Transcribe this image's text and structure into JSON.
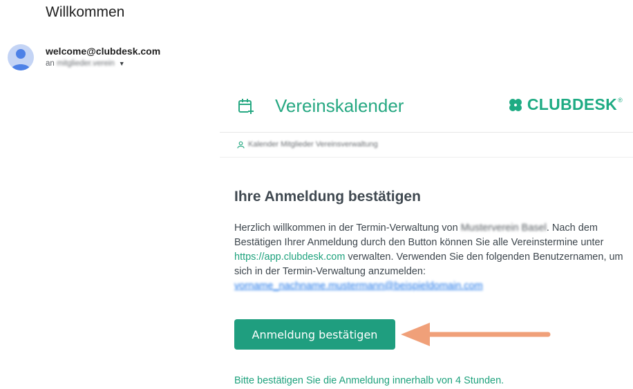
{
  "email": {
    "subject": "Willkommen",
    "sender": "welcome@clubdesk.com",
    "recipient_prefix": "an",
    "recipient_blurred": "mitglieder.verein"
  },
  "content": {
    "brand_title": "Vereinskalender",
    "logo_text": "CLUBDESK",
    "logo_reg": "®",
    "org_blurred": "Kalender Mitglieder Vereinsverwaltung",
    "heading": "Ihre Anmeldung bestätigen",
    "para_1": "Herzlich willkommen in der Termin-Verwaltung von ",
    "org_name_blurred": "Musterverein Basel",
    "para_2": ". Nach dem Bestätigen Ihrer Anmeldung durch den Button können Sie alle Vereinstermine unter ",
    "link_url": "https://app.clubdesk.com",
    "para_3": " verwalten. Verwenden Sie den folgenden Benutzernamen, um sich in der Termin-Verwaltung anzumelden:",
    "username_blurred": "vorname_nachname.mustermann@beispieldomain.com",
    "button_label": "Anmeldung bestätigen",
    "footer_note": "Bitte bestätigen Sie die Anmeldung innerhalb von 4 Stunden."
  },
  "colors": {
    "brand_green": "#1f9e7f",
    "arrow_orange": "#f0a079",
    "avatar_bg": "#c4d4f5",
    "avatar_fg": "#4d81e7"
  },
  "icons": {
    "avatar": "person-avatar-icon",
    "caret": "caret-down-icon",
    "calendar": "calendar-icon",
    "logo": "clover-logo-icon",
    "user": "user-icon",
    "arrow": "arrow-left-icon"
  }
}
